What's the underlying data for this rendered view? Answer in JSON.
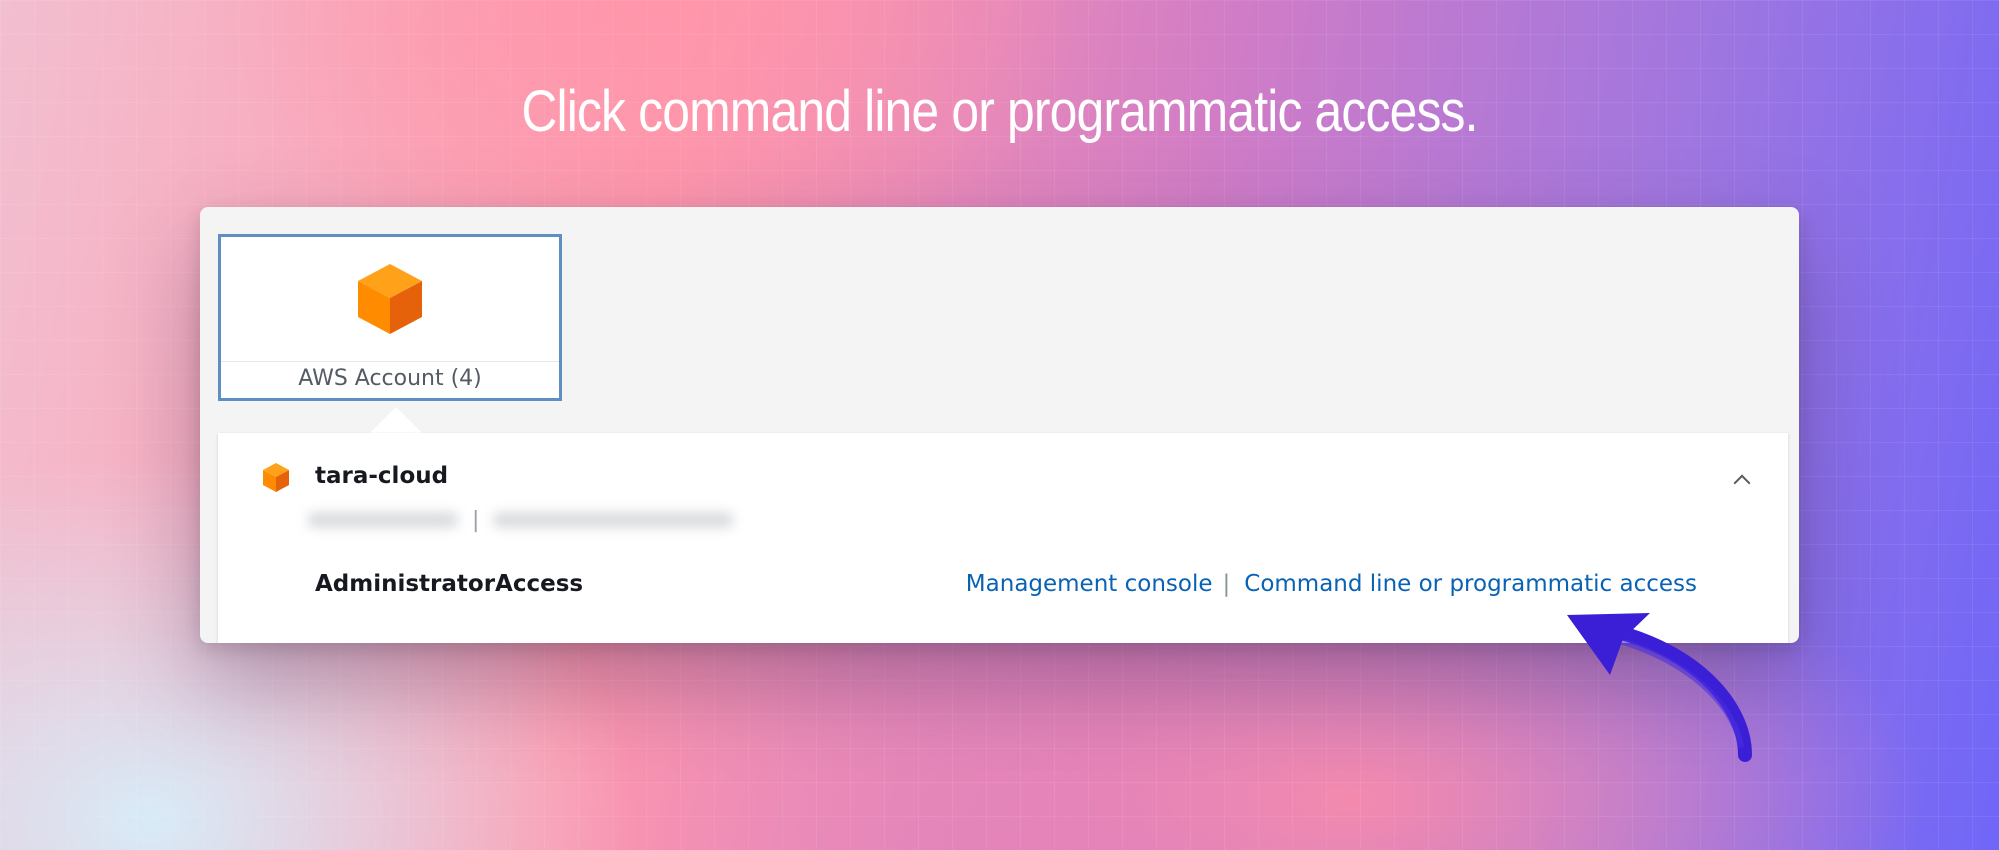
{
  "headline": "Click command line or programmatic access.",
  "app_tile": {
    "label": "AWS Account (4)",
    "icon": "aws-cube-icon"
  },
  "account": {
    "name": "tara-cloud",
    "icon": "aws-cube-icon",
    "details_separator": "|",
    "role": "AdministratorAccess",
    "management_console_link": "Management console",
    "link_separator": "|",
    "command_line_link": "Command line or programmatic access",
    "expand_icon": "chevron-up-icon"
  },
  "annotation": {
    "icon": "curved-arrow-icon",
    "color": "#3a1fd6"
  },
  "colors": {
    "link": "#0a62b4",
    "tile_border": "#5f8ec0",
    "cube_orange": "#ff8c00"
  }
}
